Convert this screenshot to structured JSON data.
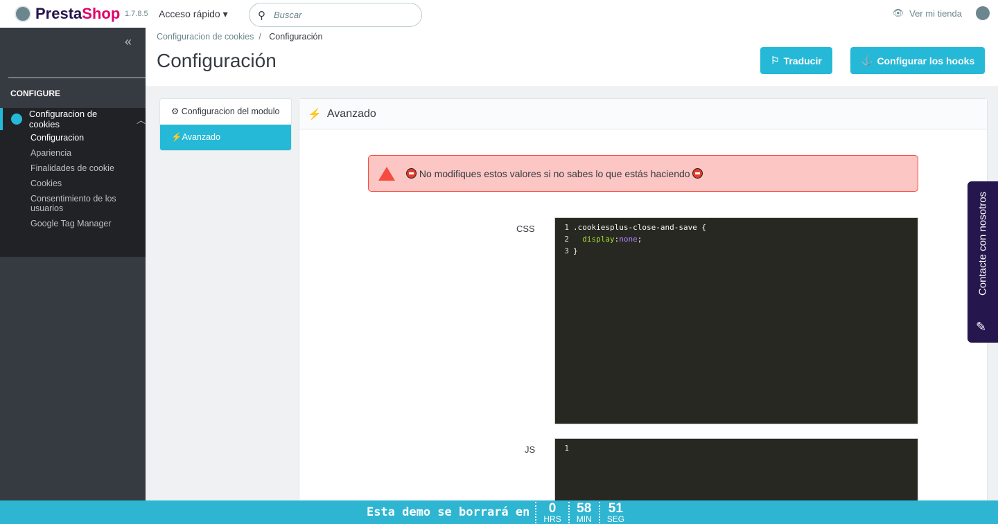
{
  "header": {
    "brand_a": "Presta",
    "brand_b": "Shop",
    "version": "1.7.8.5",
    "quick_access": "Acceso rápido",
    "search_placeholder": "Buscar",
    "view_store": "Ver mi tienda"
  },
  "sidebar": {
    "section": "CONFIGURE",
    "module": "Configuracion de cookies",
    "items": [
      {
        "label": "Configuracion",
        "active": true
      },
      {
        "label": "Apariencia"
      },
      {
        "label": "Finalidades de cookie"
      },
      {
        "label": "Cookies"
      },
      {
        "label": "Consentimiento de los usuarios"
      },
      {
        "label": "Google Tag Manager"
      }
    ]
  },
  "breadcrumb": {
    "parent": "Configuracion de cookies",
    "current": "Configuración"
  },
  "page": {
    "title": "Configuración",
    "translate": "Traducir",
    "hooks": "Configurar los hooks"
  },
  "tabs": [
    {
      "label": "Configuracion del modulo"
    },
    {
      "label": "Avanzado",
      "active": true
    }
  ],
  "panel": {
    "title": "Avanzado",
    "alert": "No modifiques estos valores si no sabes lo que estás haciendo",
    "css_label": "CSS",
    "js_label": "JS",
    "css_lines": [
      {
        "n": "1",
        "text": ".cookiesplus-close-and-save {"
      },
      {
        "n": "2",
        "prop": "display",
        "val": "none"
      },
      {
        "n": "3",
        "text": "}"
      }
    ],
    "js_lines": [
      {
        "n": "1"
      }
    ]
  },
  "contact": "Contacte con nosotros",
  "countdown": {
    "text": "Esta demo se borrará en",
    "hours": "0",
    "hours_unit": "HRS",
    "minutes": "58",
    "minutes_unit": "MIN",
    "seconds": "51",
    "seconds_unit": "SEG"
  }
}
